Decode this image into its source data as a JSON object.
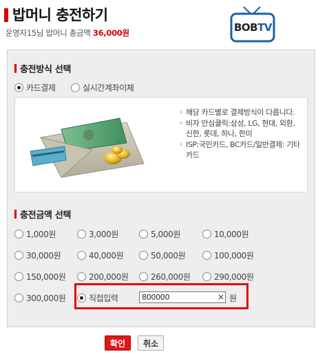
{
  "header": {
    "title": "밥머니 충전하기",
    "subtitle_prefix": "운영자15님 밥머니 총금액",
    "subtitle_amount": "36,000원",
    "logo_text": "BOB",
    "logo_tv": "TV"
  },
  "method_section": {
    "title": "충전방식 선택",
    "options": [
      {
        "label": "카드결제",
        "selected": true
      },
      {
        "label": "실시간계좌이체",
        "selected": false
      }
    ],
    "info": [
      "해당 카드별로 결제방식이 다릅니다.",
      "비자 안심클릭:삼성, LG, 현대, 외환, 신한, 롯데, 하나, 한미",
      "ISP:국민카드, BC카드/일반결제: 기타카드"
    ]
  },
  "amount_section": {
    "title": "충전금액 선택",
    "options": [
      {
        "label": "1,000원",
        "selected": false
      },
      {
        "label": "3,000원",
        "selected": false
      },
      {
        "label": "5,000원",
        "selected": false
      },
      {
        "label": "10,000원",
        "selected": false
      },
      {
        "label": "30,000원",
        "selected": false
      },
      {
        "label": "40,000원",
        "selected": false
      },
      {
        "label": "50,000원",
        "selected": false
      },
      {
        "label": "100,000원",
        "selected": false
      },
      {
        "label": "150,000원",
        "selected": false
      },
      {
        "label": "200,000원",
        "selected": false
      },
      {
        "label": "260,000원",
        "selected": false
      },
      {
        "label": "290,000원",
        "selected": false
      },
      {
        "label": "300,000원",
        "selected": false
      },
      {
        "label": "직접입력",
        "selected": true
      }
    ],
    "custom_value": "800000",
    "clear_icon": "×",
    "unit": "원"
  },
  "buttons": {
    "confirm": "확인",
    "cancel": "취소"
  },
  "colors": {
    "accent": "#d90000",
    "highlight": "#e60000",
    "panel": "#eeeeee"
  }
}
